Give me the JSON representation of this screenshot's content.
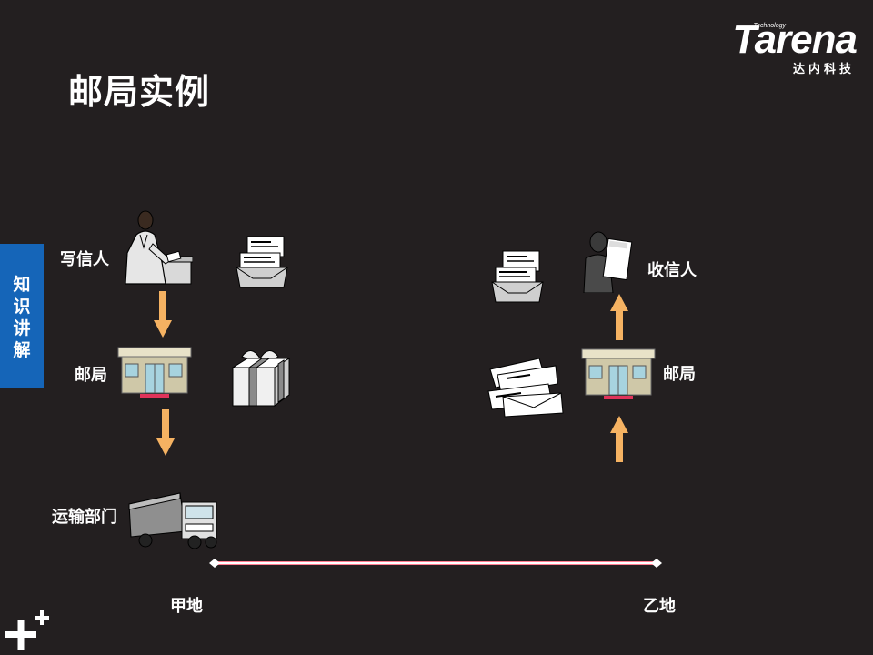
{
  "slide": {
    "title": "邮局实例",
    "side_tab": [
      "知",
      "识",
      "讲",
      "解"
    ]
  },
  "logo": {
    "brand": "Tarena",
    "tagline": "Technology",
    "cn_name": "达内科技"
  },
  "labels": {
    "sender": "写信人",
    "post_office_left": "邮局",
    "transport": "运输部门",
    "receiver": "收信人",
    "post_office_right": "邮局",
    "place_a": "甲地",
    "place_b": "乙地"
  },
  "colors": {
    "background": "#231f20",
    "tab": "#1565b8",
    "arrow": "#f5b262",
    "route": "#ffffff",
    "route_edge": "#ff7b8f"
  }
}
